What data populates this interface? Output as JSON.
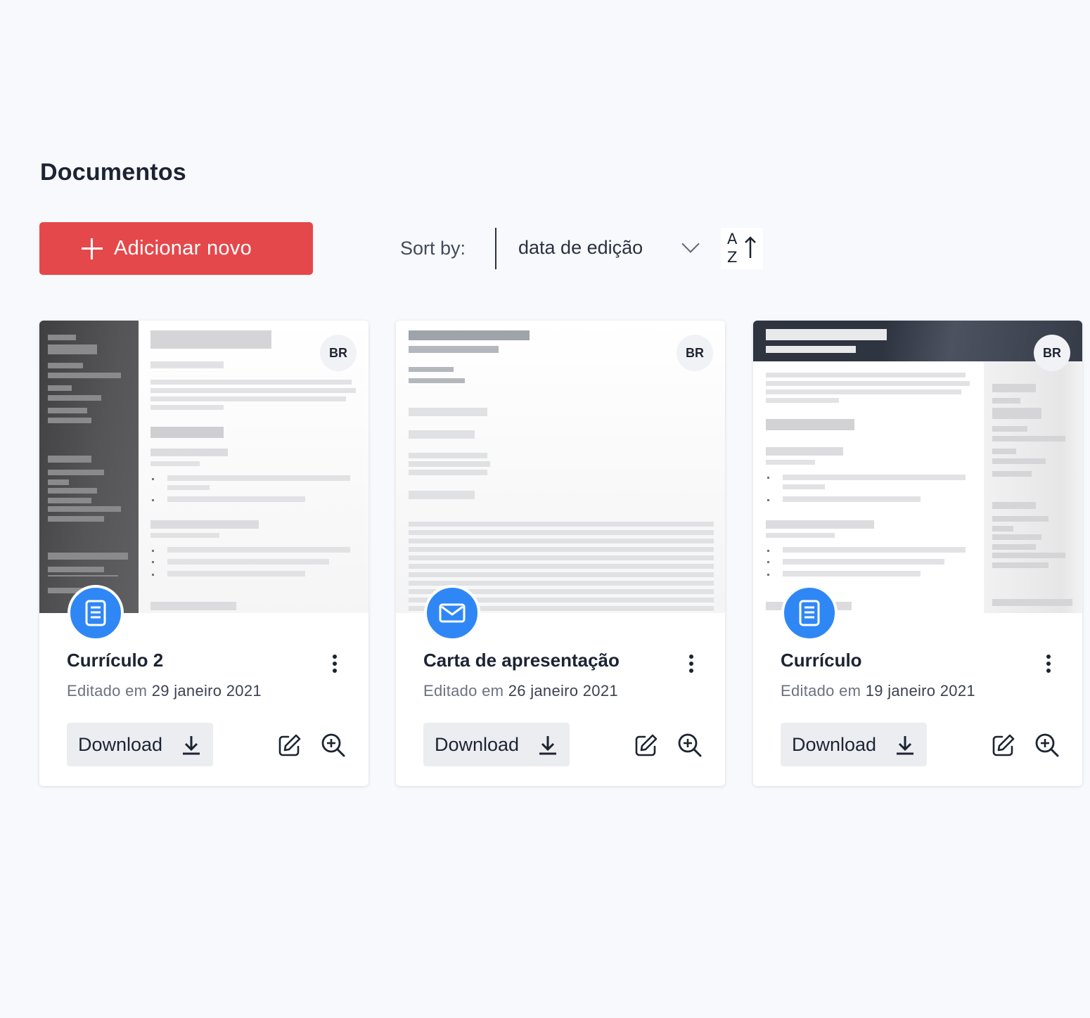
{
  "page": {
    "title": "Documentos"
  },
  "toolbar": {
    "add_label": "Adicionar novo",
    "sort_label": "Sort by:",
    "sort_value": "data de edição",
    "sort_dir_top": "A",
    "sort_dir_bottom": "Z"
  },
  "colors": {
    "accent": "#e5484b",
    "icon_blue": "#2f87f5",
    "background": "#f8f9fc"
  },
  "cards": [
    {
      "title": "Currículo 2",
      "edited_prefix": "Editado em",
      "edited_date": "29 janeiro 2021",
      "lang": "BR",
      "type_icon": "document-icon",
      "download_label": "Download"
    },
    {
      "title": "Carta de apresentação",
      "edited_prefix": "Editado em",
      "edited_date": "26 janeiro 2021",
      "lang": "BR",
      "type_icon": "envelope-icon",
      "download_label": "Download"
    },
    {
      "title": "Currículo",
      "edited_prefix": "Editado em",
      "edited_date": "19 janeiro 2021",
      "lang": "BR",
      "type_icon": "document-icon",
      "download_label": "Download"
    }
  ]
}
